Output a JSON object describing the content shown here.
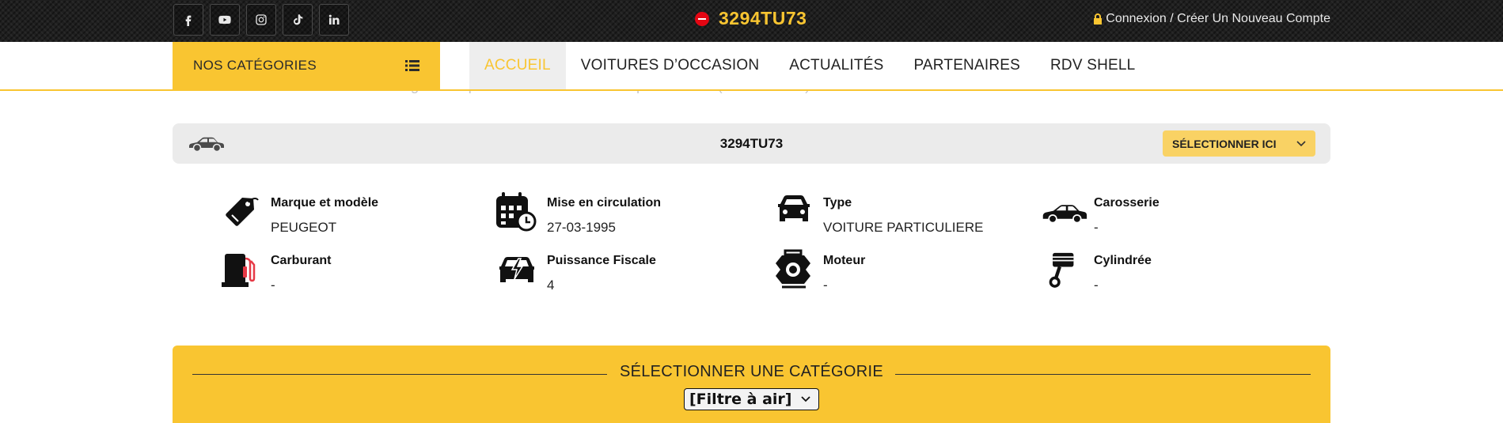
{
  "topbar": {
    "social": [
      {
        "name": "facebook-icon"
      },
      {
        "name": "youtube-icon"
      },
      {
        "name": "instagram-icon"
      },
      {
        "name": "tiktok-icon"
      },
      {
        "name": "linkedin-icon"
      }
    ],
    "plate": "3294TU73",
    "login_label": "Connexion / Créer Un Nouveau Compte"
  },
  "nav": {
    "categories_label": "NOS CATÉGORIES",
    "items": [
      {
        "label": "ACCUEIL",
        "active": true
      },
      {
        "label": "VOITURES D’OCCASION",
        "active": false
      },
      {
        "label": "ACTUALITÉS",
        "active": false
      },
      {
        "label": "PARTENAIRES",
        "active": false
      },
      {
        "label": "RDV SHELL",
        "active": false
      }
    ]
  },
  "partial_text": "Accès essentiellement sur le catalogue des pièces automobiles. Marque Actuelle (Particulières)",
  "vehicle": {
    "plate": "3294TU73",
    "select_label": "SÉLECTIONNER ICI",
    "specs": [
      {
        "icon": "price-tag-icon",
        "label": "Marque et modèle",
        "value": "PEUGEOT"
      },
      {
        "icon": "calendar-clock-icon",
        "label": "Mise en circulation",
        "value": "27-03-1995"
      },
      {
        "icon": "car-front-icon",
        "label": "Type",
        "value": "VOITURE PARTICULIERE"
      },
      {
        "icon": "car-side-icon",
        "label": "Carosserie",
        "value": "-"
      },
      {
        "icon": "fuel-pump-icon",
        "label": "Carburant",
        "value": "-"
      },
      {
        "icon": "car-power-icon",
        "label": "Puissance Fiscale",
        "value": "4"
      },
      {
        "icon": "engine-icon",
        "label": "Moteur",
        "value": "-"
      },
      {
        "icon": "piston-icon",
        "label": "Cylindrée",
        "value": "-"
      }
    ]
  },
  "category": {
    "title": "SÉLECTIONNER UNE CATÉGORIE",
    "selected": "[Filtre à air]"
  },
  "colors": {
    "accent": "#f9c531",
    "topbar": "#1f1f1f",
    "card": "#ebebeb"
  }
}
